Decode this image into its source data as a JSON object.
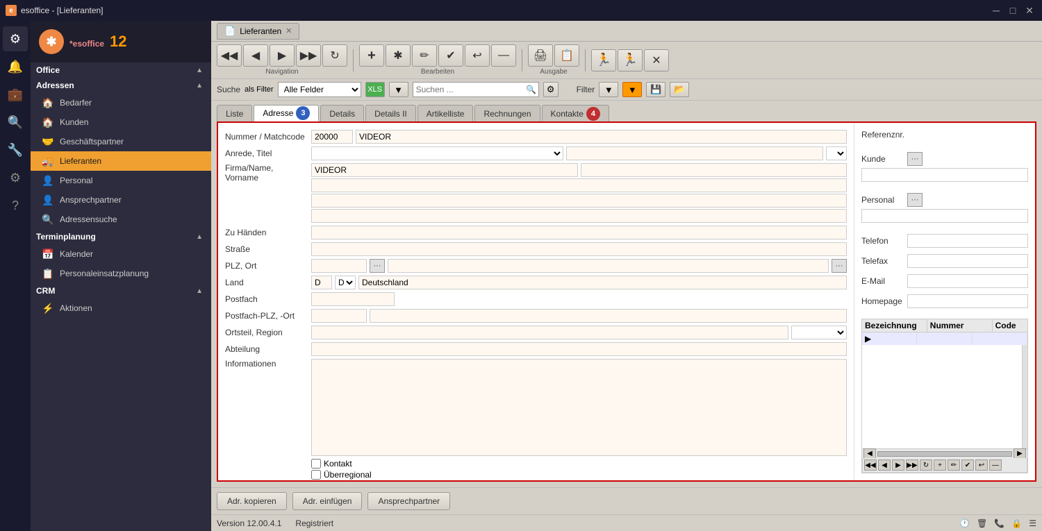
{
  "titlebar": {
    "title": "esoffice - [Lieferanten]",
    "icon": "e"
  },
  "sidebar": {
    "logo": {
      "text": "es",
      "brand": "office",
      "version": "12"
    },
    "office_label": "Office",
    "sections": [
      {
        "label": "Adressen",
        "items": [
          {
            "label": "Bedarfer",
            "icon": "🏠"
          },
          {
            "label": "Kunden",
            "icon": "🏠"
          },
          {
            "label": "Geschäftspartner",
            "icon": "🤝"
          },
          {
            "label": "Lieferanten",
            "icon": "🚚",
            "active": true
          },
          {
            "label": "Personal",
            "icon": "👤"
          },
          {
            "label": "Ansprechpartner",
            "icon": "👤"
          },
          {
            "label": "Adressensuche",
            "icon": "🔍"
          }
        ]
      },
      {
        "label": "Terminplanung",
        "items": [
          {
            "label": "Kalender",
            "icon": "📅"
          },
          {
            "label": "Personaleinsatzplanung",
            "icon": "📋"
          }
        ]
      },
      {
        "label": "CRM",
        "items": [
          {
            "label": "Aktionen",
            "icon": "⚡"
          }
        ]
      }
    ],
    "nav_icons": [
      "⚙",
      "🔔",
      "💼",
      "🔍",
      "🔧",
      "⚙",
      "?"
    ]
  },
  "doctab": {
    "label": "Lieferanten",
    "close": "✕"
  },
  "toolbar": {
    "nav_label": "Navigation",
    "edit_label": "Bearbeiten",
    "output_label": "Ausgabe",
    "nav_buttons": [
      {
        "icon": "◀◀",
        "title": "Erster"
      },
      {
        "icon": "◀",
        "title": "Zurück"
      },
      {
        "icon": "▶",
        "title": "Vor"
      },
      {
        "icon": "▶▶",
        "title": "Letzter"
      },
      {
        "icon": "↻",
        "title": "Aktualisieren"
      }
    ],
    "edit_buttons": [
      {
        "icon": "+",
        "title": "Neu"
      },
      {
        "icon": "✱",
        "title": "Kopieren"
      },
      {
        "icon": "✏",
        "title": "Bearbeiten"
      },
      {
        "icon": "✔",
        "title": "Speichern"
      },
      {
        "icon": "↩",
        "title": "Zurücksetzen"
      },
      {
        "icon": "—",
        "title": "Löschen"
      }
    ],
    "output_buttons": [
      {
        "icon": "🖨",
        "title": "Drucken"
      },
      {
        "icon": "📄",
        "title": "Export"
      }
    ],
    "extra_buttons": [
      {
        "icon": "🏃",
        "title": "Aktion1"
      },
      {
        "icon": "🏃",
        "title": "Aktion2"
      },
      {
        "icon": "✕",
        "title": "Schließen"
      }
    ]
  },
  "search": {
    "label": "Suche",
    "als_filter": "als Filter",
    "field_value": "Alle Felder",
    "filter_label": "Filter",
    "search_placeholder": "Suchen ..."
  },
  "tabs": {
    "items": [
      {
        "label": "Liste",
        "badge": ""
      },
      {
        "label": "Adresse",
        "badge": "3",
        "active": true
      },
      {
        "label": "Details",
        "badge": ""
      },
      {
        "label": "Details II",
        "badge": ""
      },
      {
        "label": "Artikelliste",
        "badge": ""
      },
      {
        "label": "Rechnungen",
        "badge": ""
      },
      {
        "label": "Kontakte",
        "badge": "4"
      }
    ]
  },
  "form": {
    "nummer_label": "Nummer / Matchcode",
    "nummer_value": "20000",
    "matchcode_value": "VIDEOR",
    "anrede_label": "Anrede, Titel",
    "anrede_value": "",
    "titel_value": "",
    "firma_label": "Firma/Name, Vorname",
    "firma_value": "VIDEOR",
    "firma_line2": "",
    "firma_line3": "",
    "firma_line4": "",
    "zuhaenden_label": "Zu Händen",
    "zuhaenden_value": "",
    "strasse_label": "Straße",
    "strasse_value": "",
    "plz_label": "PLZ, Ort",
    "plz_value": "",
    "ort_value": "",
    "land_label": "Land",
    "land_code": "D",
    "land_name": "Deutschland",
    "postfach_label": "Postfach",
    "postfach_value": "",
    "postfach_plz_label": "Postfach-PLZ, -Ort",
    "postfach_plz": "",
    "postfach_ort": "",
    "ortsteil_label": "Ortsteil, Region",
    "ortsteil_value": "",
    "region_value": "",
    "abteilung_label": "Abteilung",
    "abteilung_value": "",
    "informationen_label": "Informationen",
    "kontakt_label": "Kontakt",
    "kontakt_checked": false,
    "ueberregional_label": "Überregional",
    "ueberregional_checked": false
  },
  "right_panel": {
    "referenznr_label": "Referenznr.",
    "referenznr_value": "",
    "kunde_label": "Kunde",
    "kunde_value": "",
    "kunde_name": "",
    "personal_label": "Personal",
    "personal_value": "",
    "personal_name": "",
    "telefon_label": "Telefon",
    "telefon_value": "",
    "telefax_label": "Telefax",
    "telefax_value": "",
    "email_label": "E-Mail",
    "email_value": "",
    "homepage_label": "Homepage",
    "homepage_value": "",
    "table_headers": [
      "Bezeichnung",
      "Nummer",
      "Code"
    ],
    "table_arrow_row": true
  },
  "bottom_buttons": [
    {
      "label": "Adr. kopieren"
    },
    {
      "label": "Adr. einfügen"
    },
    {
      "label": "Ansprechpartner"
    }
  ],
  "status_bar": {
    "version": "Version 12.00.4.1",
    "registered": "Registriert"
  }
}
